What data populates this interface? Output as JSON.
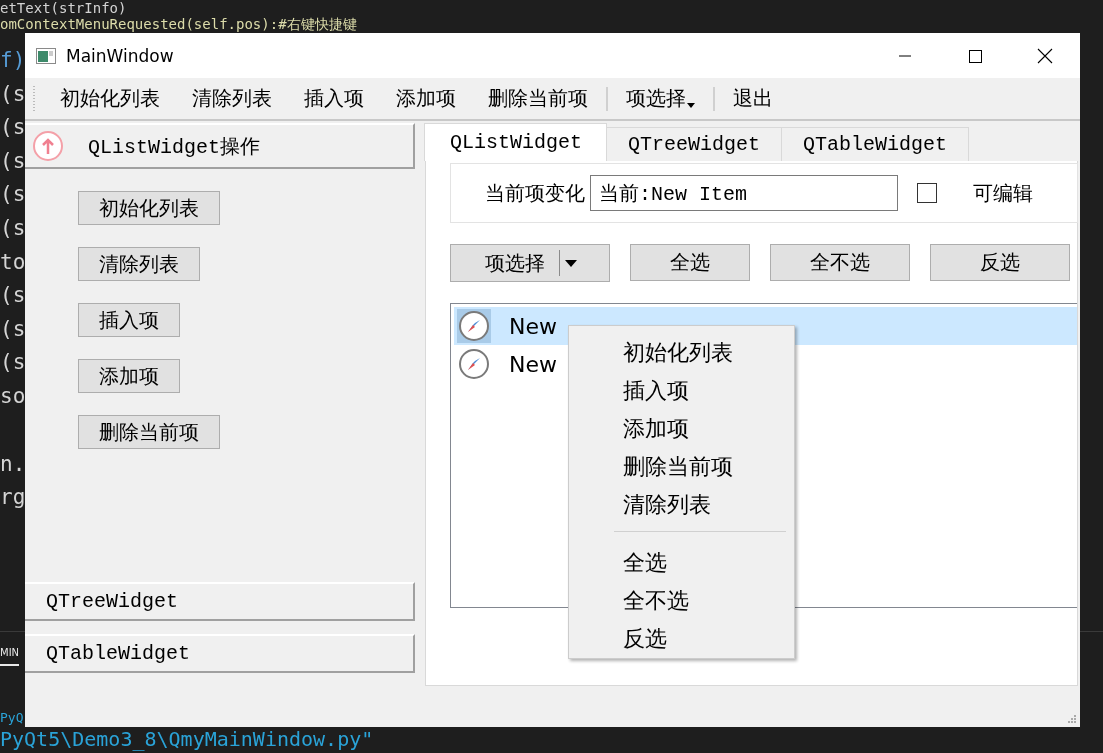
{
  "editor": {
    "code_lines": [
      "etText(strInfo)",
      "omContextMenuRequested(self.pos):#右键快捷键",
      "f)",
      "(s",
      "(s",
      "(s",
      "(s",
      "(s",
      "to",
      "(s",
      "(s",
      "(s",
      "so"
    ],
    "lower_lines": [
      "n.",
      "rg"
    ],
    "panel_tab": "MIN",
    "terminal_lines": [
      "PyQ",
      "PyQt5\\Demo3_8\\QmyMainWindow.py\""
    ]
  },
  "window": {
    "title": "MainWindow"
  },
  "toolbar": [
    {
      "kind": "action",
      "label": "初始化列表"
    },
    {
      "kind": "action",
      "label": "清除列表"
    },
    {
      "kind": "action",
      "label": "插入项"
    },
    {
      "kind": "action",
      "label": "添加项"
    },
    {
      "kind": "action",
      "label": "删除当前项"
    },
    {
      "kind": "separator"
    },
    {
      "kind": "menu",
      "label": "项选择"
    },
    {
      "kind": "separator"
    },
    {
      "kind": "action",
      "label": "退出"
    }
  ],
  "toolbox": [
    {
      "title": "QListWidget操作",
      "expanded": true,
      "buttons": [
        "初始化列表",
        "清除列表",
        "插入项",
        "添加项",
        "删除当前项"
      ]
    },
    {
      "title": "QTreeWidget",
      "expanded": false
    },
    {
      "title": "QTableWidget",
      "expanded": false
    }
  ],
  "tabs": [
    {
      "label": "QListWidget",
      "selected": true
    },
    {
      "label": "QTreeWidget",
      "selected": false
    },
    {
      "label": "QTableWidget",
      "selected": false
    }
  ],
  "current_item": {
    "label": "当前项变化",
    "value": "当前:New Item",
    "editable": {
      "label": "可编辑",
      "checked": false
    }
  },
  "buttons": [
    {
      "kind": "split",
      "label": "项选择"
    },
    {
      "kind": "plain",
      "label": "全选"
    },
    {
      "kind": "plain",
      "label": "全不选"
    },
    {
      "kind": "plain",
      "label": "反选"
    }
  ],
  "list": [
    {
      "text": "New",
      "selected": true
    },
    {
      "text": "New",
      "selected": false
    }
  ],
  "context_menu": [
    {
      "kind": "item",
      "label": "初始化列表"
    },
    {
      "kind": "item",
      "label": "插入项"
    },
    {
      "kind": "item",
      "label": "添加项"
    },
    {
      "kind": "item",
      "label": "删除当前项"
    },
    {
      "kind": "item",
      "label": "清除列表"
    },
    {
      "kind": "separator"
    },
    {
      "kind": "item",
      "label": "全选"
    },
    {
      "kind": "item",
      "label": "全不选"
    },
    {
      "kind": "item",
      "label": "反选"
    }
  ]
}
